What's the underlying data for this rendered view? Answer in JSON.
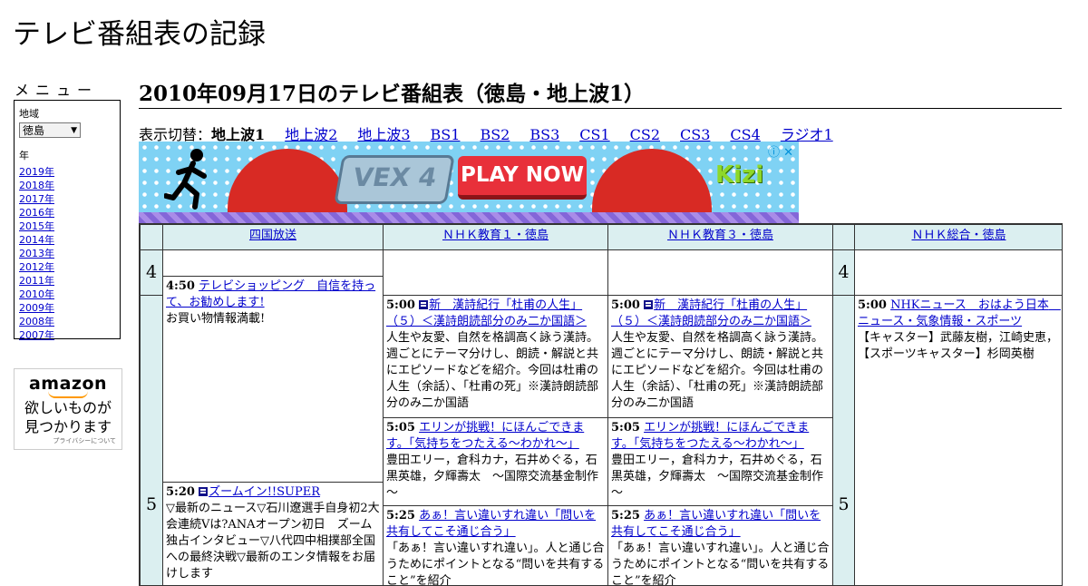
{
  "site": {
    "title": "テレビ番組表の記録"
  },
  "menu": {
    "label": "メニュー",
    "region_label": "地域",
    "region_value": "徳島",
    "year_label": "年",
    "years": [
      "2019年",
      "2018年",
      "2017年",
      "2016年",
      "2015年",
      "2014年",
      "2013年",
      "2012年",
      "2011年",
      "2010年",
      "2009年",
      "2008年",
      "2007年"
    ]
  },
  "amazon": {
    "logo": "amazon",
    "line1": "欲しいものが",
    "line2": "見つかります",
    "privacy": "プライバシーについて"
  },
  "page": {
    "heading": "2010年09月17日のテレビ番組表（徳島・地上波1）"
  },
  "switcher": {
    "label": "表示切替：",
    "current": "地上波1",
    "links": [
      "地上波2",
      "地上波3",
      "BS1",
      "BS2",
      "BS3",
      "CS1",
      "CS2",
      "CS3",
      "CS4",
      "ラジオ1"
    ]
  },
  "ad": {
    "logo_text": "VEX 4",
    "play_label": "PLAY NOW",
    "brand": "Kizi",
    "info_icon": "info-icon",
    "close_icon": "close-icon",
    "info_glyph": "ⓘ",
    "close_glyph": "✕"
  },
  "schedule": {
    "channels": [
      "四国放送",
      "ＮＨＫ教育１・徳島",
      "ＮＨＫ教育３・徳島",
      "ＮＨＫ総合・徳島"
    ],
    "hours": [
      "4",
      "5"
    ],
    "programs": {
      "shikoku_0450": {
        "time": "4:50",
        "title": "テレビショッピング　自信を持って、お勧めします!",
        "desc": "お買い物情報満載!"
      },
      "shikoku_0520": {
        "time": "5:20",
        "title": "ズームイン!!SUPER",
        "desc": "▽最新のニュース▽石川遼選手自身初2大会連続Vは?ANAオープン初日　ズーム独占インタビュー▽八代四中相撲部全国への最終決戦▽最新のエンタ情報をお届けします"
      },
      "edu1_0500": {
        "time": "5:00",
        "title": "新　漢詩紀行「杜甫の人生」（５）＜漢詩朗読部分のみ二か国語＞",
        "desc": "人生や友愛、自然を格調高く詠う漢詩。週ごとにテーマ分けし、朗読・解説と共にエピソードなどを紹介。今回は杜甫の人生（余話）、「杜甫の死」※漢詩朗読部分のみ二か国語"
      },
      "edu1_0505": {
        "time": "5:05",
        "title": "エリンが挑戦！にほんごできます。「気持ちをつたえる～わかれ～」",
        "desc": "豊田エリー，倉科カナ，石井めぐる，石黒英雄，夕輝壽太　～国際交流基金制作～"
      },
      "edu1_0525": {
        "time": "5:25",
        "title": "あぁ！言い違いすれ違い「問いを共有してこそ通じ合う」",
        "desc": "「あぁ！言い違いすれ違い」。人と通じ合うためにポイントとなる“問いを共有すること”を紹介"
      },
      "edu3_0500": {
        "time": "5:00",
        "title": "新　漢詩紀行「杜甫の人生」（５）＜漢詩朗読部分のみ二か国語＞",
        "desc": "人生や友愛、自然を格調高く詠う漢詩。週ごとにテーマ分けし、朗読・解説と共にエピソードなどを紹介。今回は杜甫の人生（余話）、「杜甫の死」※漢詩朗読部分のみ二か国語"
      },
      "edu3_0505": {
        "time": "5:05",
        "title": "エリンが挑戦！にほんごできます。「気持ちをつたえる～わかれ～」",
        "desc": "豊田エリー，倉科カナ，石井めぐる，石黒英雄，夕輝壽太　～国際交流基金制作～"
      },
      "edu3_0525": {
        "time": "5:25",
        "title": "あぁ！言い違いすれ違い「問いを共有してこそ通じ合う」",
        "desc": "「あぁ！言い違いすれ違い」。人と通じ合うためにポイントとなる“問いを共有すること”を紹介"
      },
      "sogo_0500": {
        "time": "5:00",
        "title": "NHKニュース　おはよう日本　ニュース・気象情報・スポーツ",
        "desc": "【キャスター】武藤友樹，江崎史恵，【スポーツキャスター】杉岡英樹"
      }
    }
  },
  "colors": {
    "link": "#0000cc",
    "header_bg": "#dbeff0",
    "ad_sky": "#7fd2f4",
    "ad_hill": "#d82a24",
    "ad_button": "#e8303a"
  }
}
